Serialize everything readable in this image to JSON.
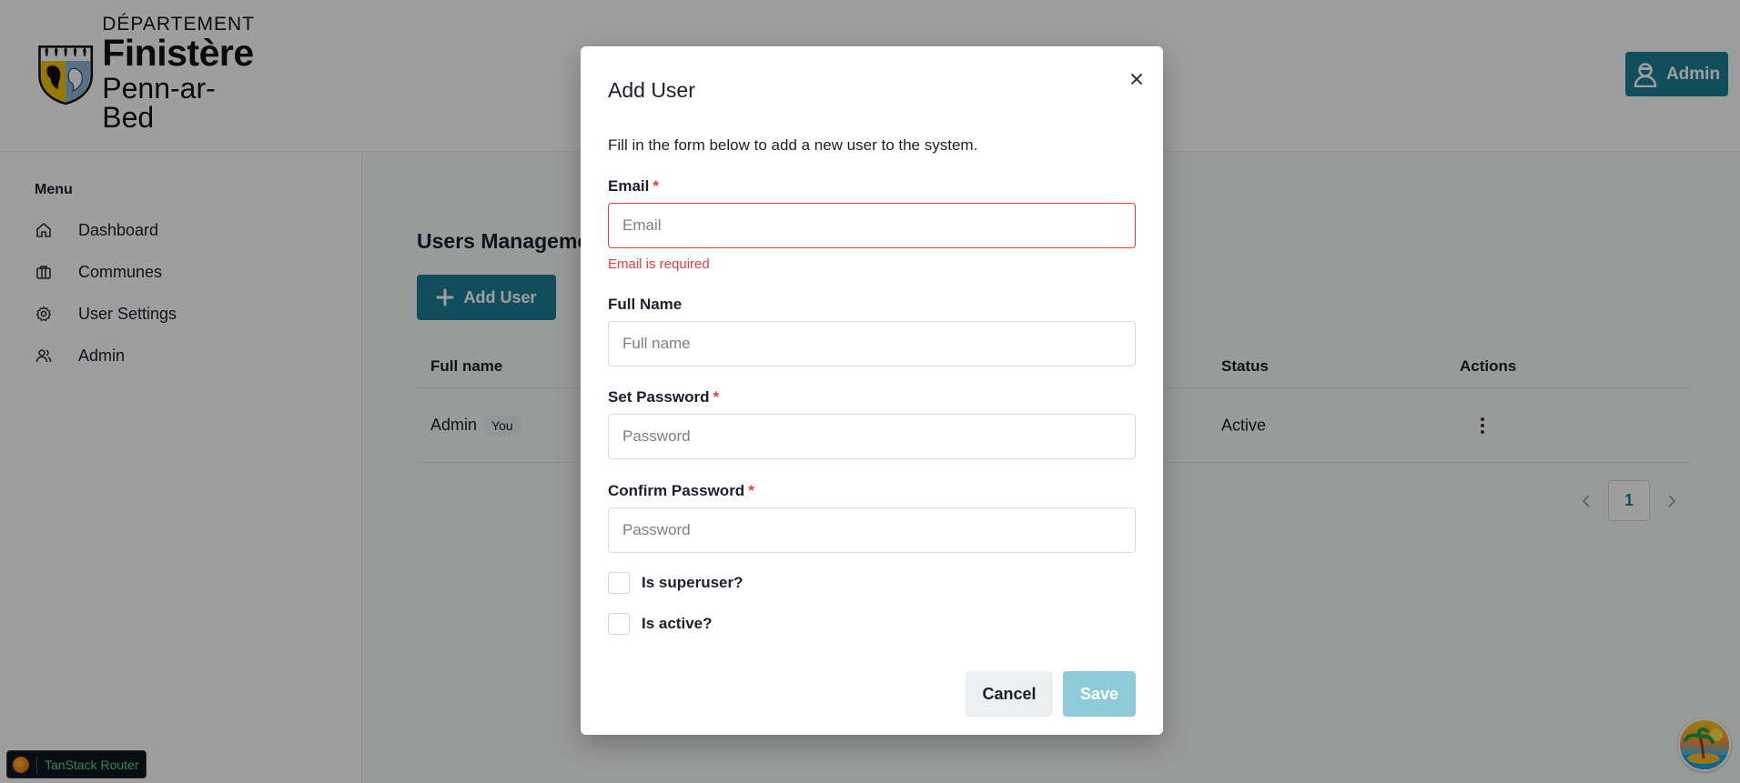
{
  "header": {
    "logo": {
      "line1": "DÉPARTEMENT",
      "line2": "Finistère",
      "line3": "Penn-ar-Bed"
    },
    "admin_button": {
      "label": "Admin",
      "icon": "user-avatar-icon"
    }
  },
  "sidebar": {
    "menu_title": "Menu",
    "items": [
      {
        "label": "Dashboard",
        "icon": "home-icon"
      },
      {
        "label": "Communes",
        "icon": "briefcase-icon"
      },
      {
        "label": "User Settings",
        "icon": "gear-icon"
      },
      {
        "label": "Admin",
        "icon": "users-icon"
      }
    ]
  },
  "main": {
    "page_title": "Users Management",
    "add_user_button": {
      "label": "Add User",
      "icon": "plus-icon"
    },
    "table": {
      "columns": [
        "Full name",
        "Status",
        "Actions"
      ],
      "rows": [
        {
          "full_name": "Admin",
          "badge": "You",
          "status": "Active"
        }
      ]
    },
    "pagination": {
      "current_page": "1"
    }
  },
  "modal": {
    "title": "Add User",
    "description": "Fill in the form below to add a new user to the system.",
    "required_marker": "*",
    "fields": {
      "email": {
        "label": "Email",
        "placeholder": "Email",
        "value": "",
        "error": "Email is required"
      },
      "full_name": {
        "label": "Full Name",
        "placeholder": "Full name",
        "value": ""
      },
      "password": {
        "label": "Set Password",
        "placeholder": "Password",
        "value": ""
      },
      "confirm_password": {
        "label": "Confirm Password",
        "placeholder": "Password",
        "value": ""
      }
    },
    "checkboxes": {
      "superuser": {
        "label": "Is superuser?",
        "checked": false
      },
      "active": {
        "label": "Is active?",
        "checked": false
      }
    },
    "cancel_label": "Cancel",
    "save_label": "Save"
  },
  "devtools": {
    "label": "TanStack Router"
  },
  "colors": {
    "primary": "#1a7f97",
    "save_disabled": "#8ecbda",
    "error": "#e53e3e"
  }
}
